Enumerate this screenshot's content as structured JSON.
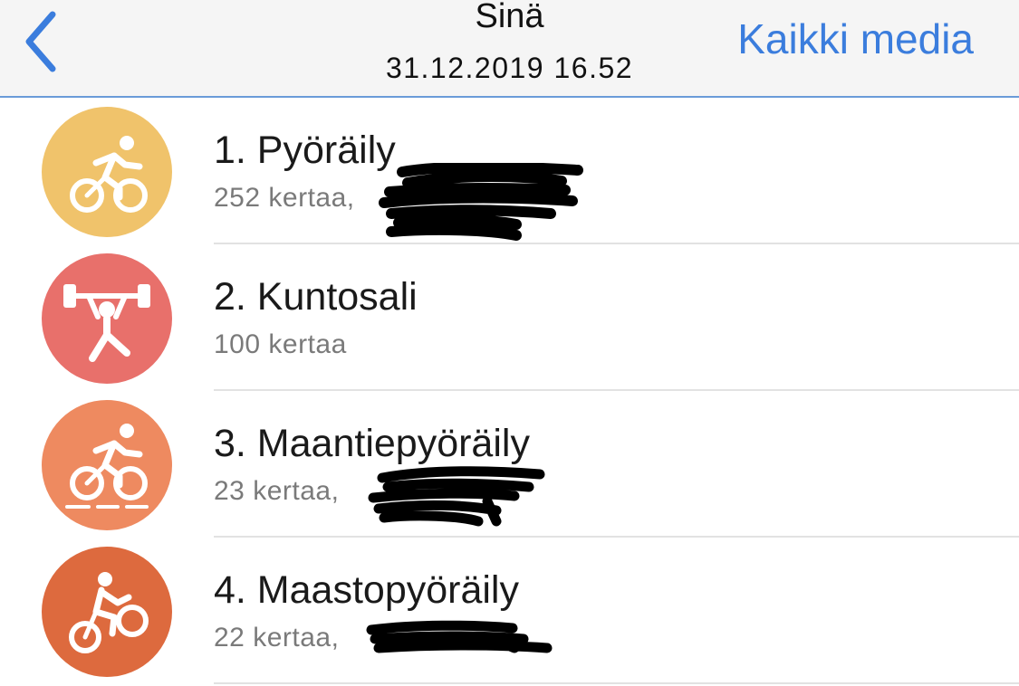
{
  "nav": {
    "title": "Sinä",
    "subtitle": "31.12.2019 16.52",
    "right_label": "Kaikki media"
  },
  "activities": [
    {
      "title": "1. Pyöräily",
      "sub": "252 kertaa,",
      "icon": "cycling-icon",
      "color": "#f0c36b"
    },
    {
      "title": "2. Kuntosali",
      "sub": "100 kertaa",
      "icon": "weightlifting-icon",
      "color": "#e8706b"
    },
    {
      "title": "3. Maantiepyöräily",
      "sub": "23 kertaa,",
      "icon": "road-cycling-icon",
      "color": "#ee8a60"
    },
    {
      "title": "4. Maastopyöräily",
      "sub": "22 kertaa,",
      "icon": "mountain-biking-icon",
      "color": "#dd6a3e"
    }
  ],
  "colors": {
    "accent": "#3b7ddd",
    "navbar_bg": "#f5f5f5",
    "redaction": "#000000"
  }
}
